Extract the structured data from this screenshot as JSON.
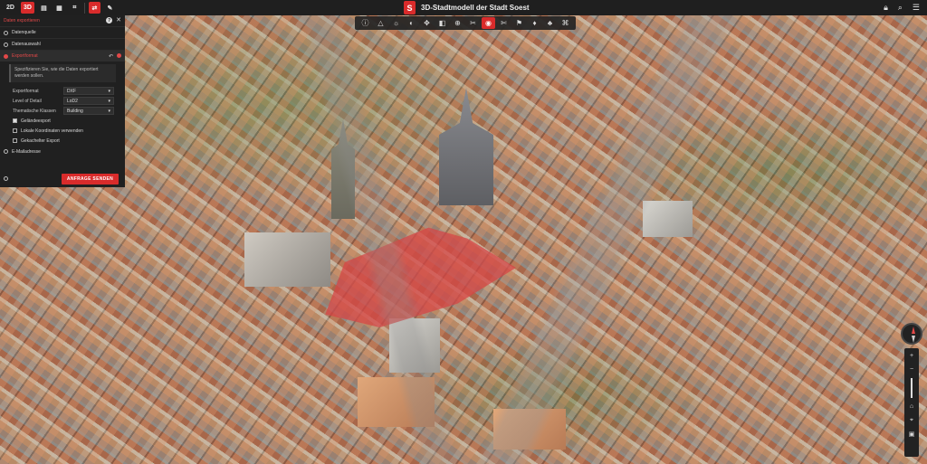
{
  "topbar": {
    "view_2d": "2D",
    "view_3d": "3D",
    "title": "3D-Stadtmodell der Stadt Soest",
    "logo_letter": "S",
    "left_icons": [
      "layers-icon",
      "grid-icon",
      "export-icon",
      "draw-icon"
    ],
    "right_icons": [
      "lock-icon",
      "search-icon",
      "menu-icon"
    ]
  },
  "toolbar": {
    "icons": [
      "info-icon",
      "measure-triangle-icon",
      "shadow-icon",
      "sun-icon",
      "move-icon",
      "transparency-icon",
      "pointer-icon",
      "clip-icon",
      "highlight-icon",
      "cut-icon",
      "flag-icon",
      "light-icon",
      "tree-icon",
      "visibility-icon",
      "grid-icon",
      "settings-icon"
    ],
    "active_index": 8
  },
  "panel": {
    "header": "Daten exportieren",
    "help": "?",
    "close": "✕",
    "steps": [
      {
        "label": "Datenquelle"
      },
      {
        "label": "Datenauswahl"
      },
      {
        "label": "Exportformat"
      }
    ],
    "info": "Spezifizieren Sie, wie die Daten exportiert werden sollen.",
    "fields": [
      {
        "label": "Exportformat",
        "value": "DXF"
      },
      {
        "label": "Level of Detail",
        "value": "LoD2"
      },
      {
        "label": "Thematische Klassen",
        "value": "Building"
      }
    ],
    "checkboxes": [
      {
        "label": "Geländeexport",
        "checked": true
      },
      {
        "label": "Lokale Koordinaten verwenden",
        "checked": false
      },
      {
        "label": "Gekachelter Export",
        "checked": false
      }
    ],
    "email_step": "E-Mailadresse",
    "send_button": "ANFRAGE SENDEN"
  },
  "navigation": {
    "icons": [
      "compass-icon",
      "zoom-in-icon",
      "zoom-out-icon",
      "tilt-icon",
      "home-icon",
      "location-icon",
      "screenshot-icon"
    ]
  },
  "colors": {
    "accent": "#d92b2b",
    "panel_bg": "#202020",
    "highlight": "#d64646"
  }
}
